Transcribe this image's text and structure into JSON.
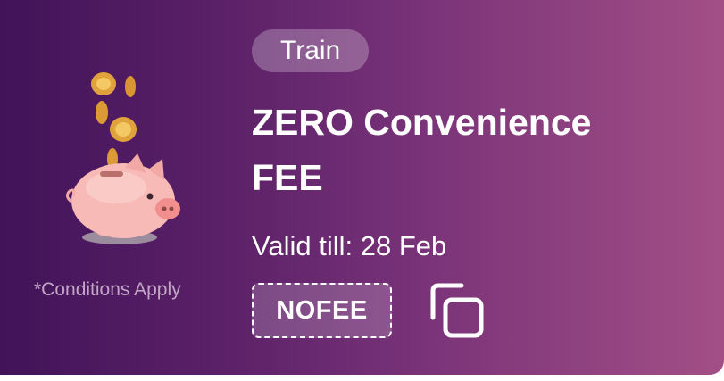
{
  "offer": {
    "category": "Train",
    "title": "ZERO Convenience FEE",
    "validity": "Valid till: 28 Feb",
    "code": "NOFEE",
    "conditions": "*Conditions Apply"
  },
  "icons": {
    "illustration": "piggy-bank-coins-icon",
    "copy": "copy-icon"
  },
  "colors": {
    "gradient_start": "#411358",
    "gradient_end": "#a34f86",
    "text": "#ffffff",
    "conditions_text": "#c3a6c7"
  }
}
